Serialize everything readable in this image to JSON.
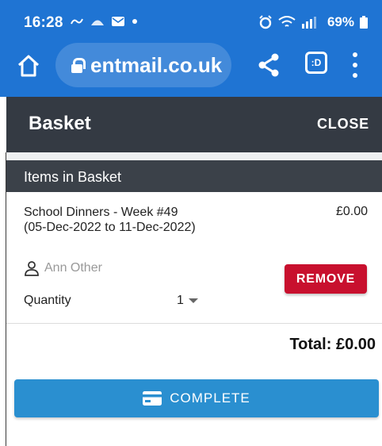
{
  "status_bar": {
    "time": "16:28",
    "battery": "69%"
  },
  "browser": {
    "url": "entmail.co.uk",
    "tabs_label": ":D"
  },
  "header": {
    "title": "Basket",
    "close_label": "CLOSE"
  },
  "basket": {
    "section_label": "Items in Basket",
    "items": [
      {
        "name": "School Dinners - Week #49 (05-Dec-2022 to 11-Dec-2022)",
        "price": "£0.00",
        "person": "Ann Other",
        "remove_label": "REMOVE",
        "quantity_label": "Quantity",
        "quantity_value": "1"
      }
    ],
    "total": "Total: £0.00",
    "complete_label": "COMPLETE"
  },
  "colors": {
    "browser_bar": "#1f74d3",
    "header": "#343a43",
    "remove_button": "#c8102e",
    "complete_button": "#2a8fd0"
  }
}
